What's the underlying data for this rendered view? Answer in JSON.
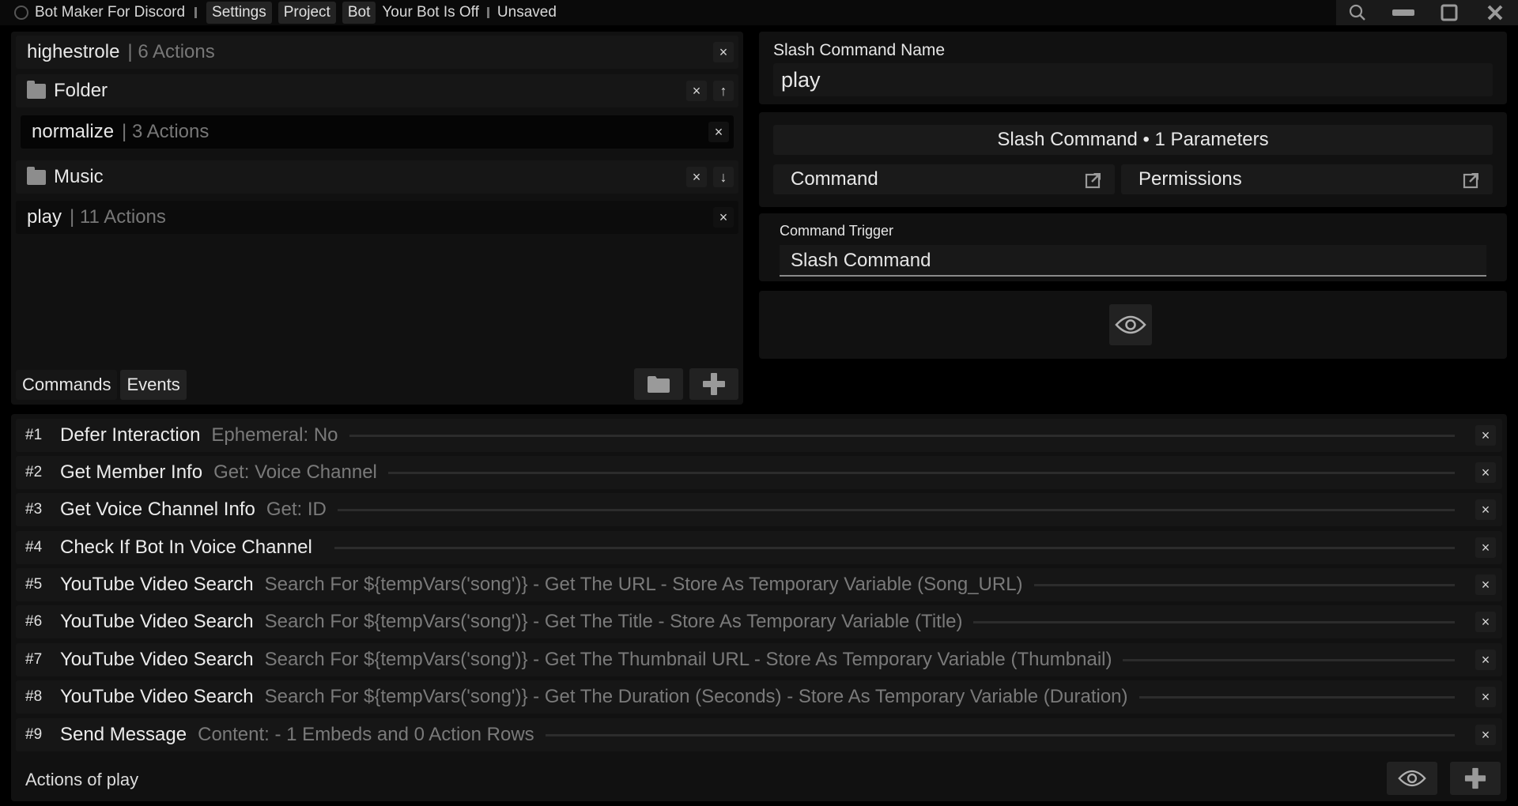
{
  "titlebar": {
    "app_name": "Bot Maker For Discord",
    "menus": [
      "Settings",
      "Project",
      "Bot"
    ],
    "bot_status": "Your Bot Is Off",
    "save_status": "Unsaved"
  },
  "commands": {
    "items": [
      {
        "name": "highestrole",
        "meta": "| 6 Actions",
        "type": "command"
      },
      {
        "name": "Folder",
        "type": "folder",
        "arrow": "↑"
      },
      {
        "name": "normalize",
        "meta": "| 3 Actions",
        "type": "command",
        "active": true
      },
      {
        "name": "Music",
        "type": "folder",
        "arrow": "↓"
      },
      {
        "name": "play",
        "meta": "| 11 Actions",
        "type": "command"
      }
    ],
    "tabs": [
      "Commands",
      "Events"
    ]
  },
  "slash": {
    "name_label": "Slash Command Name",
    "name_value": "play",
    "params_label": "Slash Command • 1 Parameters",
    "command_label": "Command",
    "permissions_label": "Permissions",
    "trigger_label": "Command Trigger",
    "trigger_value": "Slash Command"
  },
  "actions": {
    "rows": [
      {
        "num": "#1",
        "title": "Defer Interaction",
        "desc": "Ephemeral: No"
      },
      {
        "num": "#2",
        "title": "Get Member Info",
        "desc": "Get: Voice Channel"
      },
      {
        "num": "#3",
        "title": "Get Voice Channel Info",
        "desc": "Get: ID"
      },
      {
        "num": "#4",
        "title": "Check If Bot In Voice Channel",
        "desc": ""
      },
      {
        "num": "#5",
        "title": "YouTube Video Search",
        "desc": "Search For ${tempVars('song')} - Get The URL - Store As Temporary Variable (Song_URL)"
      },
      {
        "num": "#6",
        "title": "YouTube Video Search",
        "desc": "Search For ${tempVars('song')} - Get The Title - Store As Temporary Variable (Title)"
      },
      {
        "num": "#7",
        "title": "YouTube Video Search",
        "desc": "Search For ${tempVars('song')} - Get The Thumbnail URL - Store As Temporary Variable (Thumbnail)"
      },
      {
        "num": "#8",
        "title": "YouTube Video Search",
        "desc": "Search For ${tempVars('song')} - Get The Duration (Seconds) - Store As Temporary Variable (Duration)"
      },
      {
        "num": "#9",
        "title": "Send Message",
        "desc": "Content:  - 1 Embeds and 0 Action Rows"
      }
    ],
    "footer_label": "Actions of play"
  },
  "icons": {
    "close": "×",
    "search": "search-icon",
    "minimize": "minimize-icon",
    "maximize": "maximize-icon",
    "eye": "eye-icon",
    "folder": "folder-icon",
    "plus": "plus-icon",
    "external": "external-link-icon"
  },
  "colors": {
    "background": "#000000",
    "panel": "#111111",
    "row": "#161616",
    "text": "#e6e6e6",
    "muted": "#777777"
  }
}
